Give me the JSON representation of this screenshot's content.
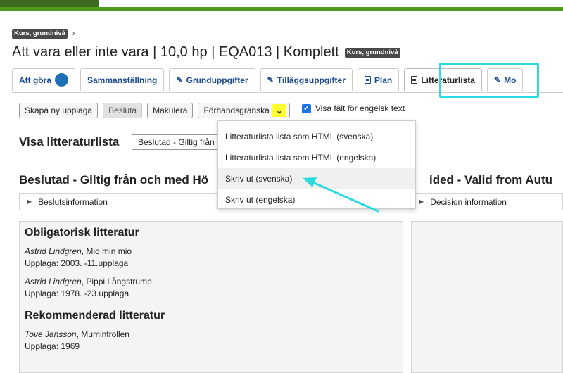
{
  "breadcrumb": {
    "badge": "Kurs, grundnivå",
    "separator": "›"
  },
  "page": {
    "title": "Att vara eller inte vara | 10,0 hp | EQA013 | Komplett",
    "title_badge": "Kurs, grundnivå"
  },
  "tabs": [
    {
      "label": "Att göra",
      "icon": "circle-badge"
    },
    {
      "label": "Sammanställning"
    },
    {
      "label": "Grunduppgifter",
      "icon": "pencil-icon"
    },
    {
      "label": "Tilläggsuppgifter",
      "icon": "pencil-icon"
    },
    {
      "label": "Plan",
      "icon": "document-icon"
    },
    {
      "label": "Litteraturlista",
      "icon": "document-icon",
      "active": true
    },
    {
      "label": "Mo",
      "icon": "pencil-icon"
    }
  ],
  "toolbar": {
    "new_edition": "Skapa ny upplaga",
    "decide": "Besluta",
    "cancel": "Makulera",
    "preview": "Förhandsgranska",
    "english_fields": "Visa fält för engelsk text"
  },
  "preview_menu": {
    "items": [
      "Litteraturlista lista som HTML (svenska)",
      "Litteraturlista lista som HTML (engelska)",
      "Skriv ut (svenska)",
      "Skriv ut (engelska)"
    ]
  },
  "view": {
    "label": "Visa litteraturlista",
    "selected": "Beslutad - Giltig från"
  },
  "left": {
    "heading": "Beslutad - Giltig från och med Hö",
    "info": "Beslutsinformation",
    "sections": [
      {
        "title": "Obligatorisk litteratur",
        "books": [
          {
            "author": "Astrid Lindgren",
            "title": ", Mio min mio",
            "edition": "Upplaga: 2003. -11.upplaga"
          },
          {
            "author": "Astrid Lindgren",
            "title": ", Pippi Långstrump",
            "edition": "Upplaga: 1978. -23.upplaga"
          }
        ]
      },
      {
        "title": "Rekommenderad litteratur",
        "books": [
          {
            "author": "Tove Jansson",
            "title": ", Mumintrollen",
            "edition": "Upplaga: 1969"
          }
        ]
      }
    ]
  },
  "right": {
    "heading": "ided - Valid from Autu",
    "info": "Decision information"
  },
  "colors": {
    "highlight": "#2fd9e0",
    "accent_green": "#4f9a1d",
    "link_blue": "#1a4a8f",
    "chevron_highlight": "#ffff33"
  }
}
